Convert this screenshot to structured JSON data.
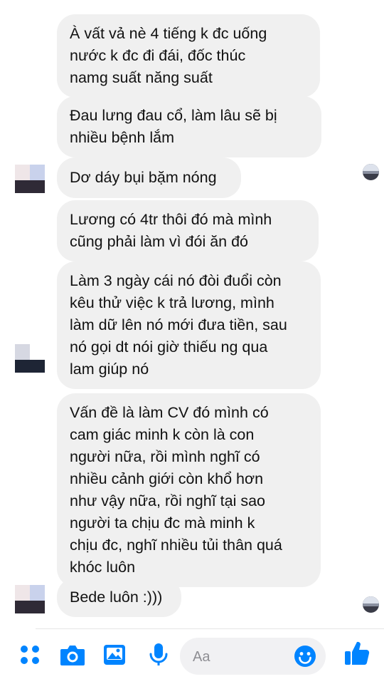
{
  "messages": [
    {
      "text": "À  vất vả nè 4 tiếng k đc uống\nnước k đc đi đái, đốc thúc\nnamg suất năng suất"
    },
    {
      "text": "Đau lưng đau cổ, làm lâu sẽ bị\nnhiều bệnh lắm"
    },
    {
      "text": "Dơ dáy bụi bặm nóng"
    },
    {
      "text": "Lương có 4tr thôi đó mà mình\ncũng phải làm vì đói ăn đó"
    },
    {
      "text": "Làm 3 ngày cái nó đòi đuổi còn\nkêu thử việc k trả lương, mình\nlàm dữ lên nó mới đưa tiền, sau\nnó gọi dt nói giờ thiếu ng qua\nlam giúp nó"
    },
    {
      "text": "Vấn đề là làm CV đó mình có\ncam giác minh k còn là con\nngười nữa, rồi mình nghĩ có\nnhiều cảnh giới còn khổ hơn\nnhư vậy nữa, rồi nghĩ tại sao\nngười ta chịu đc mà minh k\nchịu đc,  nghĩ nhiều tủi thân quá\nkhóc luôn"
    },
    {
      "text": "Bede luôn :)))"
    }
  ],
  "composer": {
    "placeholder": "Aa"
  },
  "toolbar": {
    "icons": [
      "menu-dots-icon",
      "camera-icon",
      "image-icon",
      "microphone-icon",
      "emoji-icon",
      "thumbs-up-icon"
    ],
    "accent_color": "#0084ff"
  },
  "colors": {
    "bubble_bg": "#f0f0f0",
    "text": "#111111"
  }
}
